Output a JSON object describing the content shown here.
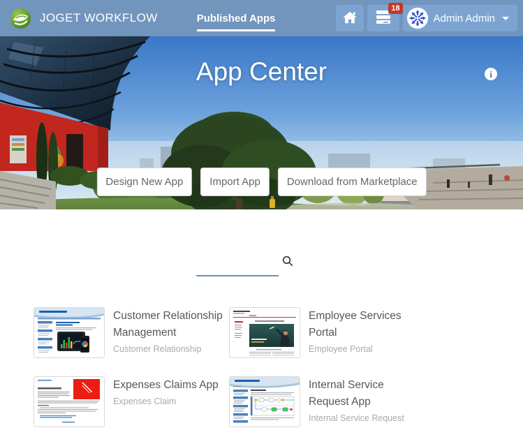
{
  "colors": {
    "navbar_bg": "#7295be",
    "nav_button_bg": "#7da4d0",
    "badge_bg": "#c0392b",
    "search_underline": "#6590c0",
    "hero_title_color": "#ffffff"
  },
  "navbar": {
    "brand": "JOGET WORKFLOW",
    "tab": "Published Apps",
    "notification_count": "18",
    "user": "Admin Admin",
    "icons": [
      "joget-logo",
      "home-icon",
      "inbox-icon",
      "user-avatar",
      "caret-down-icon"
    ]
  },
  "hero": {
    "title": "App Center",
    "info_icon": "info-icon",
    "buttons": [
      {
        "label": "Design New App"
      },
      {
        "label": "Import App"
      },
      {
        "label": "Download from Marketplace"
      }
    ]
  },
  "search": {
    "value": "",
    "icon": "search-icon"
  },
  "apps": [
    {
      "title": "Customer Relationship Management",
      "subtitle": "Customer Relationship",
      "thumbnail": "crm-app-screenshot"
    },
    {
      "title": "Employee Services Portal",
      "subtitle": "Employee Portal",
      "thumbnail": "employee-services-portal-screenshot"
    },
    {
      "title": "Expenses Claims App",
      "subtitle": "Expenses Claim",
      "thumbnail": "expenses-claims-screenshot"
    },
    {
      "title": "Internal Service Request App",
      "subtitle": "Internal Service Request",
      "thumbnail": "internal-service-request-screenshot"
    }
  ]
}
